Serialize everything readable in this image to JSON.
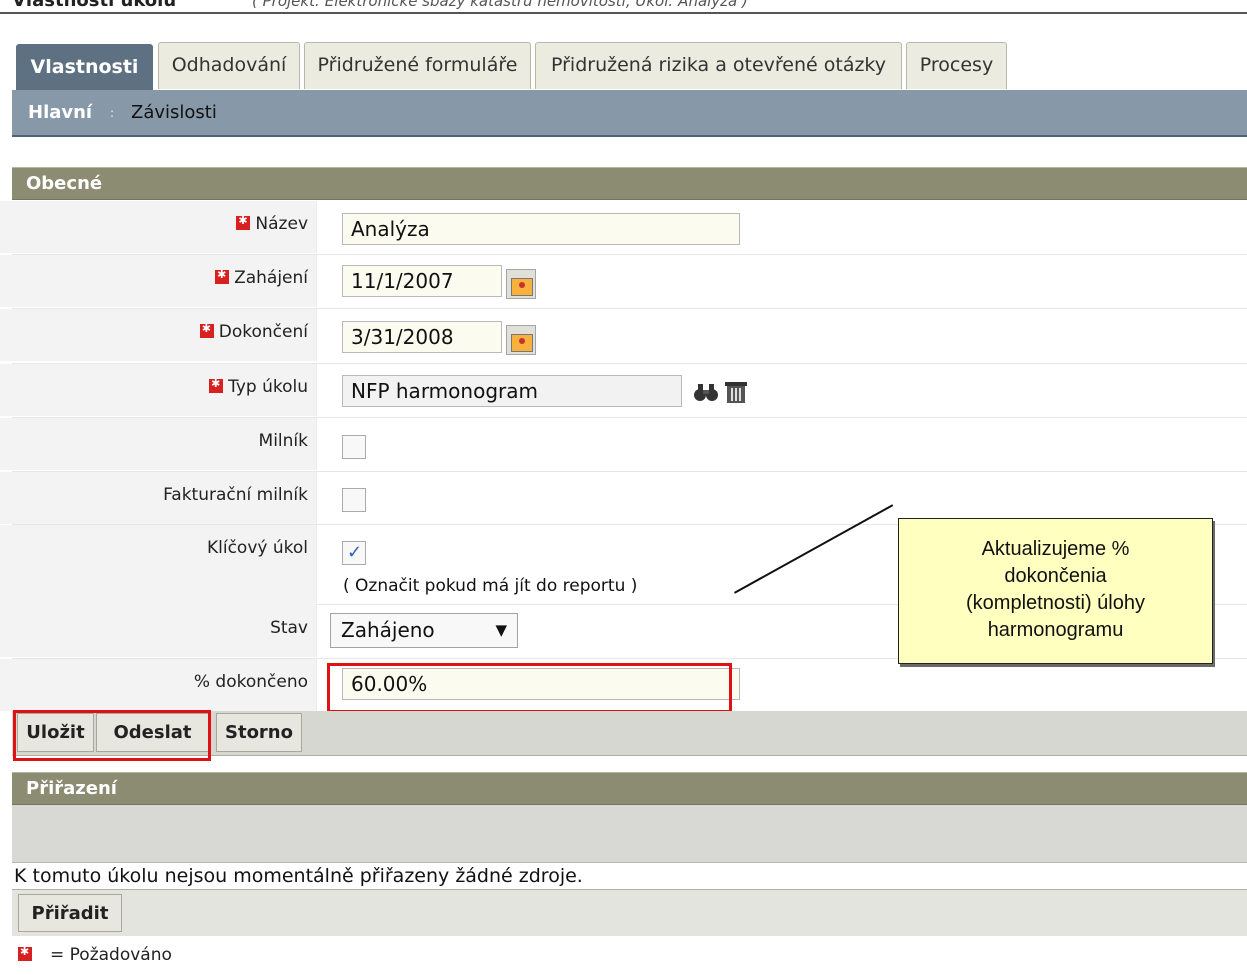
{
  "header": {
    "title": "Vlastnosti úkolu",
    "context": "( Projekt: Elektronické sbázy katastru nemovitostí, Úkol: Analýza )"
  },
  "tabs": [
    {
      "label": "Vlastnosti"
    },
    {
      "label": "Odhadování"
    },
    {
      "label": "Přidružené formuláře"
    },
    {
      "label": "Přidružená rizika a otevřené otázky"
    },
    {
      "label": "Procesy"
    }
  ],
  "subnav": {
    "items": [
      "Hlavní",
      "Závislosti"
    ],
    "separator": ":"
  },
  "general": {
    "title": "Obecné",
    "fields": {
      "name": {
        "label": "Název",
        "value": "Analýza"
      },
      "start": {
        "label": "Zahájení",
        "value": "11/1/2007"
      },
      "finish": {
        "label": "Dokončení",
        "value": "3/31/2008"
      },
      "task_type": {
        "label": "Typ úkolu",
        "value": "NFP harmonogram"
      },
      "milestone": {
        "label": "Milník"
      },
      "billing_milestone": {
        "label": "Fakturační milník"
      },
      "key_task": {
        "label": "Klíčový úkol",
        "hint": "( Označit pokud má jít do reportu )"
      },
      "status": {
        "label": "Stav",
        "value": "Zahájeno"
      },
      "percent_complete": {
        "label": "% dokončeno",
        "value": "60.00%"
      }
    }
  },
  "actions": {
    "save": "Uložit",
    "submit": "Odeslat",
    "cancel": "Storno"
  },
  "assignments": {
    "title": "Přiřazení",
    "message": "K tomuto úkolu nejsou momentálně přiřazeny žádné zdroje.",
    "assign_button": "Přiřadit"
  },
  "legend": {
    "required_text": "= Požadováno"
  },
  "callout": {
    "lines": [
      "Aktualizujeme %",
      "dokončenia",
      "(kompletnosti) úlohy",
      "harmonogramu"
    ]
  },
  "colors": {
    "tab_active": "#5e7183",
    "subnav": "#8799a9",
    "section": "#8c8c73",
    "required": "#d82020",
    "highlight": "#e01015",
    "callout": "#ffffc0"
  },
  "icons": {
    "calendar": "calendar-icon",
    "search": "binoculars-icon",
    "delete": "trash-icon",
    "dropdown": "chevron-down-icon",
    "required": "required-icon"
  }
}
